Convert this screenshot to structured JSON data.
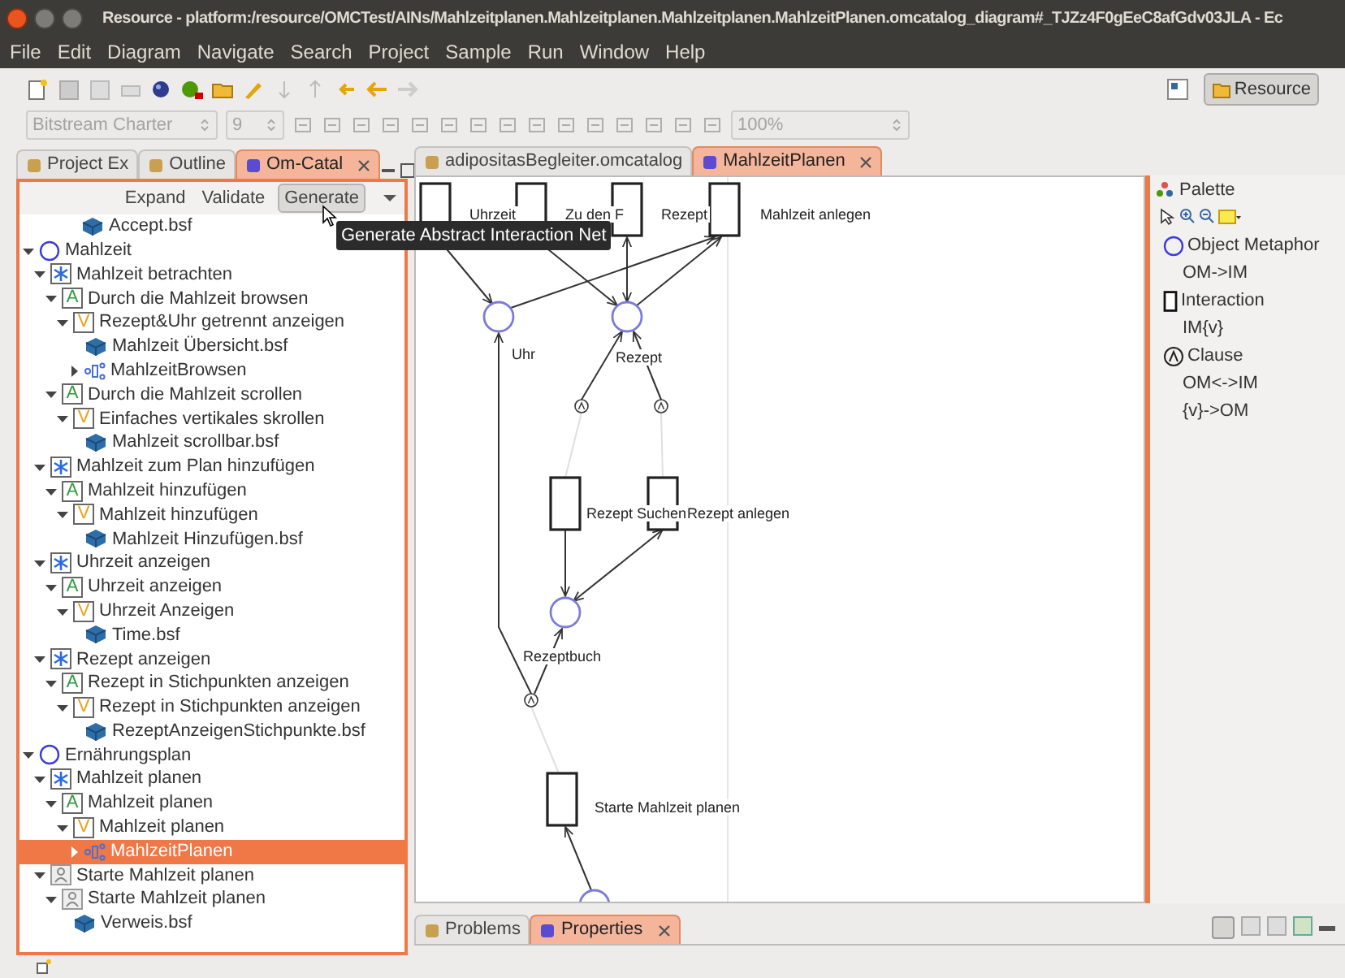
{
  "window": {
    "title": "Resource - platform:/resource/OMCTest/AINs/Mahlzeitplanen.Mahlzeitplanen.Mahlzeitplanen.MahlzeitPlanen.omcatalog_diagram#_TJZz4F0gEeC8afGdv03JLA - Ec"
  },
  "menu": [
    "File",
    "Edit",
    "Diagram",
    "Navigate",
    "Search",
    "Project",
    "Sample",
    "Run",
    "Window",
    "Help"
  ],
  "toolbar": {
    "font": "Bitstream Charter",
    "size": "9",
    "zoom": "100%",
    "perspective": "Resource"
  },
  "left_tabs": [
    {
      "label": "Project Ex",
      "selected": false
    },
    {
      "label": "Outline",
      "selected": false
    },
    {
      "label": "Om-Catal",
      "selected": true
    }
  ],
  "view_actions": [
    "Expand",
    "Validate",
    "Generate"
  ],
  "tooltip": "Generate Abstract Interaction Net",
  "scrolled_row": {
    "label": "Accept.bsf",
    "kind": "bsf"
  },
  "tree": [
    {
      "label": "Mahlzeit",
      "kind": "metaphor",
      "expanded": true,
      "selected": false,
      "children": [
        {
          "label": "Mahlzeit betrachten",
          "kind": "aspect",
          "expanded": true,
          "selected": false,
          "children": [
            {
              "label": "Durch die Mahlzeit browsen",
              "kind": "abstract",
              "badge": "A",
              "expanded": true,
              "selected": false,
              "children": [
                {
                  "label": "Rezept&Uhr getrennt anzeigen",
                  "kind": "view",
                  "badge": "V",
                  "expanded": true,
                  "selected": false,
                  "children": [
                    {
                      "label": "Mahlzeit Übersicht.bsf",
                      "kind": "bsf",
                      "selected": false
                    },
                    {
                      "label": "MahlzeitBrowsen",
                      "kind": "net",
                      "expanded": false,
                      "selected": false
                    }
                  ]
                }
              ]
            },
            {
              "label": "Durch die Mahlzeit scrollen",
              "kind": "abstract",
              "badge": "A",
              "expanded": true,
              "selected": false,
              "children": [
                {
                  "label": "Einfaches vertikales skrollen",
                  "kind": "view",
                  "badge": "V",
                  "expanded": true,
                  "selected": false,
                  "children": [
                    {
                      "label": "Mahlzeit scrollbar.bsf",
                      "kind": "bsf",
                      "selected": false
                    }
                  ]
                }
              ]
            }
          ]
        },
        {
          "label": "Mahlzeit zum Plan hinzufügen",
          "kind": "aspect",
          "expanded": true,
          "selected": false,
          "children": [
            {
              "label": "Mahlzeit hinzufügen",
              "kind": "abstract",
              "badge": "A",
              "expanded": true,
              "selected": false,
              "children": [
                {
                  "label": "Mahlzeit hinzufügen",
                  "kind": "view",
                  "badge": "V",
                  "expanded": true,
                  "selected": false,
                  "children": [
                    {
                      "label": "Mahlzeit Hinzufügen.bsf",
                      "kind": "bsf",
                      "selected": false
                    }
                  ]
                }
              ]
            }
          ]
        },
        {
          "label": "Uhrzeit anzeigen",
          "kind": "aspect",
          "expanded": true,
          "selected": false,
          "children": [
            {
              "label": "Uhrzeit anzeigen",
              "kind": "abstract",
              "badge": "A",
              "expanded": true,
              "selected": false,
              "children": [
                {
                  "label": "Uhrzeit Anzeigen",
                  "kind": "view",
                  "badge": "V",
                  "expanded": true,
                  "selected": false,
                  "children": [
                    {
                      "label": "Time.bsf",
                      "kind": "bsf",
                      "selected": false
                    }
                  ]
                }
              ]
            }
          ]
        },
        {
          "label": "Rezept anzeigen",
          "kind": "aspect",
          "expanded": true,
          "selected": false,
          "children": [
            {
              "label": "Rezept in Stichpunkten anzeigen",
              "kind": "abstract",
              "badge": "A",
              "expanded": true,
              "selected": false,
              "children": [
                {
                  "label": "Rezept in Stichpunkten anzeigen",
                  "kind": "view",
                  "badge": "V",
                  "expanded": true,
                  "selected": false,
                  "children": [
                    {
                      "label": "RezeptAnzeigenStichpunkte.bsf",
                      "kind": "bsf",
                      "selected": false
                    }
                  ]
                }
              ]
            }
          ]
        }
      ]
    },
    {
      "label": "Ernährungsplan",
      "kind": "metaphor",
      "expanded": true,
      "selected": false,
      "children": [
        {
          "label": "Mahlzeit planen",
          "kind": "aspect",
          "expanded": true,
          "selected": false,
          "children": [
            {
              "label": "Mahlzeit planen",
              "kind": "abstract",
              "badge": "A",
              "expanded": true,
              "selected": false,
              "children": [
                {
                  "label": "Mahlzeit planen",
                  "kind": "view",
                  "badge": "V",
                  "expanded": true,
                  "selected": false,
                  "children": [
                    {
                      "label": "MahlzeitPlanen",
                      "kind": "net",
                      "expanded": false,
                      "selected": true
                    }
                  ]
                }
              ]
            }
          ]
        },
        {
          "label": "Starte Mahlzeit planen",
          "kind": "person",
          "expanded": true,
          "selected": false,
          "children": [
            {
              "label": "Starte Mahlzeit planen",
              "kind": "person",
              "expanded": true,
              "selected": false,
              "children": [
                {
                  "label": "Verweis.bsf",
                  "kind": "bsf",
                  "selected": false
                }
              ]
            }
          ]
        }
      ]
    }
  ],
  "editor_tabs": [
    {
      "label": "adipositasBegleiter.omcatalog",
      "selected": false
    },
    {
      "label": "MahlzeitPlanen",
      "selected": true
    }
  ],
  "diagram": {
    "nodes": [
      {
        "kind": "interaction",
        "label": "Uhrzeit"
      },
      {
        "kind": "interaction",
        "label": "Zu den F"
      },
      {
        "kind": "interaction",
        "label": "Rezept"
      },
      {
        "kind": "interaction",
        "label": "Mahlzeit anlegen"
      },
      {
        "kind": "object",
        "label": "Uhr"
      },
      {
        "kind": "object",
        "label": "Rezept"
      },
      {
        "kind": "clause"
      },
      {
        "kind": "clause"
      },
      {
        "kind": "interaction",
        "label": "Rezept Suchen"
      },
      {
        "kind": "interaction",
        "label": "Rezept anlegen"
      },
      {
        "kind": "object",
        "label": "Rezeptbuch"
      },
      {
        "kind": "clause"
      },
      {
        "kind": "interaction",
        "label": "Starte Mahlzeit planen"
      },
      {
        "kind": "object"
      }
    ]
  },
  "palette": {
    "title": "Palette",
    "entries": [
      {
        "kind": "object",
        "label": "Object Metaphor"
      },
      {
        "kind": "connection",
        "label": "OM->IM"
      },
      {
        "kind": "interaction",
        "label": "Interaction"
      },
      {
        "kind": "connection",
        "label": "IM{v}"
      },
      {
        "kind": "clause",
        "label": "Clause"
      },
      {
        "kind": "connection",
        "label": "OM<->IM"
      },
      {
        "kind": "connection",
        "label": "{v}->OM"
      }
    ]
  },
  "bottom_tabs": [
    {
      "label": "Problems",
      "selected": false
    },
    {
      "label": "Properties",
      "selected": true
    }
  ]
}
